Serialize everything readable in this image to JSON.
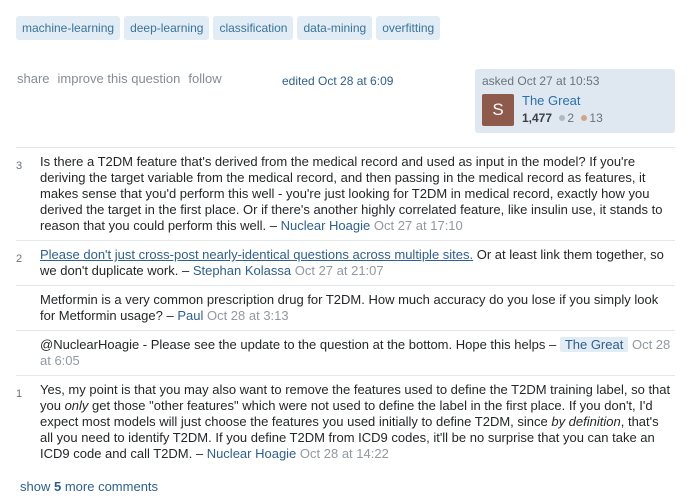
{
  "tags": [
    "machine-learning",
    "deep-learning",
    "classification",
    "data-mining",
    "overfitting"
  ],
  "post_menu": {
    "share": "share",
    "improve": "improve this question",
    "follow": "follow"
  },
  "edited": "edited Oct 28 at 6:09",
  "owner": {
    "asked": "asked Oct 27 at 10:53",
    "avatar_letter": "S",
    "name": "The Great",
    "reputation": "1,477",
    "silver": "2",
    "bronze": "13"
  },
  "comments": [
    {
      "score": "3",
      "text": "Is there a T2DM feature that's derived from the medical record and used as input in the model? If you're deriving the target variable from the medical record, and then passing in the medical record as features, it makes sense that you'd perform this well - you're just looking for T2DM in medical record, exactly how you derived the target in the first place. Or if there's another highly correlated feature, like insulin use, it stands to reason that you could perform this well. –",
      "user": "Nuclear Hoagie",
      "time": "Oct 27 at 17:10"
    },
    {
      "score": "2",
      "link": "Please don't just cross-post nearly-identical questions across multiple sites.",
      "text": " Or at least link them together, so we don't duplicate work. –",
      "user": "Stephan Kolassa",
      "time": "Oct 27 at 21:07"
    },
    {
      "score": "",
      "text": "Metformin is a very common prescription drug for T2DM. How much accuracy do you lose if you simply look for Metformin usage? –",
      "user": "Paul",
      "time": "Oct 28 at 3:13"
    },
    {
      "score": "",
      "text": "@NuclearHoagie - Please see the update to the question at the bottom. Hope this helps –",
      "user": "The Great",
      "time": "Oct 28 at 6:05"
    },
    {
      "score": "1",
      "text_a": "Yes, my point is that you may also want to remove the features used to define the T2DM training label, so that you ",
      "em_a": "only",
      "text_b": " get those \"other features\" which were not used to define the label in the first place. If you don't, I'd expect most models will just choose the features you used initially to define T2DM, since ",
      "em_b": "by definition",
      "text_c": ", that's all you need to identify T2DM. If you define T2DM from ICD9 codes, it'll be no surprise that you can take an ICD9 code and call T2DM. –",
      "user": "Nuclear Hoagie",
      "time": "Oct 28 at 14:22"
    }
  ],
  "show_more": {
    "prefix": "show",
    "count": "5",
    "suffix": "more comments"
  }
}
